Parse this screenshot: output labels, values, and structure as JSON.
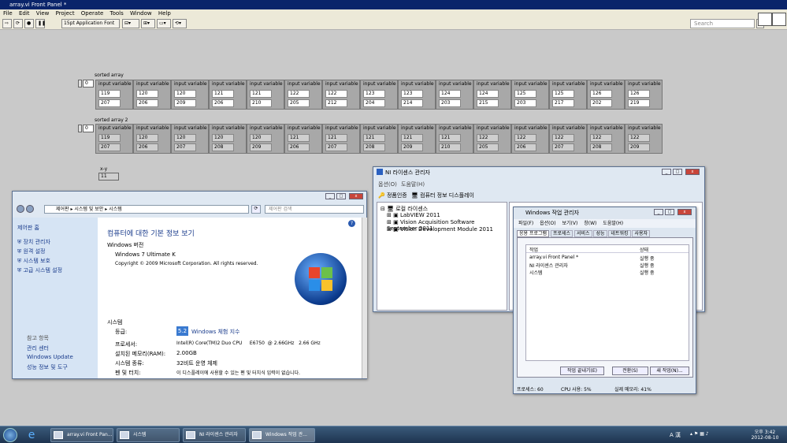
{
  "labview": {
    "title": "array.vi Front Panel *",
    "menu": [
      "File",
      "Edit",
      "View",
      "Project",
      "Operate",
      "Tools",
      "Window",
      "Help"
    ],
    "font_selector": "15pt Application Font",
    "search_placeholder": "Search",
    "arrays": [
      {
        "label": "sorted array",
        "index": "0",
        "cluster_label": "input variable",
        "col1": [
          "119",
          "120",
          "120",
          "121",
          "121",
          "122",
          "122",
          "123",
          "123",
          "124",
          "124",
          "125",
          "125",
          "126",
          "126"
        ],
        "col2": [
          "207",
          "206",
          "209",
          "206",
          "210",
          "205",
          "212",
          "204",
          "214",
          "203",
          "215",
          "203",
          "217",
          "202",
          "219"
        ]
      },
      {
        "label": "sorted array 2",
        "index": "0",
        "cluster_label": "input variable",
        "col1": [
          "119",
          "120",
          "120",
          "120",
          "120",
          "121",
          "121",
          "121",
          "121",
          "121",
          "122",
          "122",
          "122",
          "122",
          "122"
        ],
        "col2": [
          "207",
          "206",
          "207",
          "208",
          "209",
          "206",
          "207",
          "208",
          "209",
          "210",
          "205",
          "206",
          "207",
          "208",
          "209"
        ]
      }
    ],
    "xy_label": "x-y",
    "xy_value": "11"
  },
  "sysprops": {
    "breadcrumb": [
      "제어판",
      "시스템 및 보안",
      "시스템"
    ],
    "search_placeholder": "제어판 검색",
    "sidebar_home": "제어판 홈",
    "sidebar_links": [
      "장치 관리자",
      "원격 설정",
      "시스템 보호",
      "고급 시스템 설정"
    ],
    "see_also": "참고 항목",
    "see_also_links": [
      "관리 센터",
      "Windows Update",
      "성능 정보 및 도구"
    ],
    "heading": "컴퓨터에 대한 기본 정보 보기",
    "edition_section": "Windows 버전",
    "edition": "Windows 7 Ultimate K",
    "copyright": "Copyright © 2009 Microsoft Corporation. All rights reserved.",
    "system_section": "시스템",
    "rating_label": "등급:",
    "rating_value": "5.2",
    "rating_link": "Windows 체험 지수",
    "rows": [
      {
        "k": "프로세서:",
        "v": "Intel(R) Core(TM)2 Duo CPU     E6750  @ 2.66GHz   2.66 GHz"
      },
      {
        "k": "설치된 메모리(RAM):",
        "v": "2.00GB"
      },
      {
        "k": "시스템 종류:",
        "v": "32비트 운영 체제"
      },
      {
        "k": "펜 및 터치:",
        "v": "이 디스플레이에 사용할 수 있는 펜 및 터치식 입력이 없습니다."
      }
    ]
  },
  "nilicense": {
    "title": "NI 라이센스 관리자",
    "menu": [
      "옵션(O)",
      "도움말(H)"
    ],
    "toolbar": [
      "정품인증",
      "컴퓨터 정보 디스플레이"
    ],
    "tree_root": "로컬 라이센스",
    "tree_items": [
      "LabVIEW 2011",
      "Vision Acquisition Software September 2011",
      "Vision Development Module 2011"
    ]
  },
  "taskmgr": {
    "title": "Windows 작업 관리자",
    "menu": [
      "파일(F)",
      "옵션(O)",
      "보기(V)",
      "창(W)",
      "도움말(H)"
    ],
    "tabs": [
      "응용 프로그램",
      "프로세스",
      "서비스",
      "성능",
      "네트워킹",
      "사용자"
    ],
    "col_task": "작업",
    "col_status": "상태",
    "tasks": [
      {
        "name": "array.vi Front Panel *",
        "status": "실행 중"
      },
      {
        "name": "NI 라이센스 관리자",
        "status": "실행 중"
      },
      {
        "name": "시스템",
        "status": "실행 중"
      }
    ],
    "buttons": [
      "작업 끝내기(E)",
      "전환(S)",
      "새 작업(N)..."
    ],
    "status_processes": "프로세스: 60",
    "status_cpu": "CPU 사용: 5%",
    "status_mem": "실제 메모리: 41%"
  },
  "taskbar": {
    "items": [
      "array.vi Front Pan...",
      "시스템",
      "NI 라이센스 관리자",
      "Windows 작업 관..."
    ],
    "tray_ime": "A 漢",
    "time": "오후 3:42",
    "date": "2012-08-10"
  }
}
